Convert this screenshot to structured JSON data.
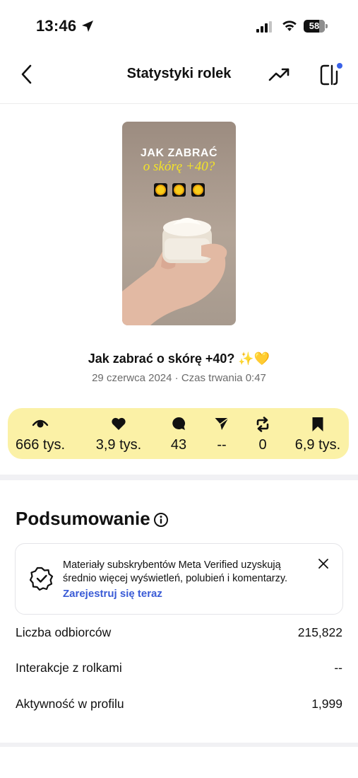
{
  "status_bar": {
    "time": "13:46",
    "battery": "58"
  },
  "header": {
    "title": "Statystyki rolek"
  },
  "thumbnail": {
    "line1": "JAK ZABRAĆ",
    "line2": "o skórę +40?"
  },
  "post": {
    "caption": "Jak zabrać o skórę +40? ✨💛",
    "meta": "29 czerwca 2024 · Czas trwania 0:47"
  },
  "stats": [
    {
      "icon": "eye-icon",
      "value": "666 tys."
    },
    {
      "icon": "heart-icon",
      "value": "3,9 tys."
    },
    {
      "icon": "comment-icon",
      "value": "43"
    },
    {
      "icon": "share-icon",
      "value": "--"
    },
    {
      "icon": "repost-icon",
      "value": "0"
    },
    {
      "icon": "bookmark-icon",
      "value": "6,9 tys."
    }
  ],
  "summary": {
    "title": "Podsumowanie",
    "banner": {
      "text": "Materiały subskrybentów Meta Verified uzyskują średnio więcej wyświetleń, polubień i komentarzy.",
      "link": "Zarejestruj się teraz"
    },
    "rows": [
      {
        "label": "Liczba odbiorców",
        "value": "215,822"
      },
      {
        "label": "Interakcje z rolkami",
        "value": "--"
      },
      {
        "label": "Aktywność w profilu",
        "value": "1,999"
      }
    ]
  },
  "colors": {
    "stats_bg": "#fbf1a6",
    "link": "#3a5bd6",
    "divider": "#f1f1f4"
  }
}
